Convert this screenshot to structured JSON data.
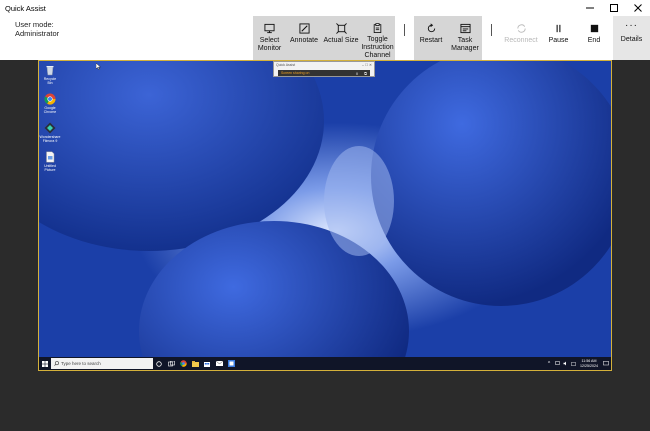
{
  "window": {
    "title": "Quick Assist",
    "minimize": "—",
    "maximize": "☐",
    "close": "✕"
  },
  "user_mode": {
    "label": "User mode:",
    "value": "Administrator"
  },
  "toolbar": {
    "select_monitor": [
      "Select",
      "Monitor"
    ],
    "annotate": "Annotate",
    "actual_size": "Actual Size",
    "toggle_channel": [
      "Toggle",
      "Instruction",
      "Channel"
    ],
    "restart": "Restart",
    "task_manager": [
      "Task",
      "Manager"
    ],
    "reconnect": "Reconnect",
    "pause": "Pause",
    "end": "End",
    "details": "Details"
  },
  "remote_desktop": {
    "icons": [
      {
        "name": "recycle-bin",
        "label": "Recycle Bin"
      },
      {
        "name": "chrome",
        "label": "Google Chrome"
      },
      {
        "name": "wondershare",
        "label": "Wondershare Filmora 9"
      },
      {
        "name": "untitled-picture",
        "label": "Untitled Picture"
      }
    ],
    "mini_quick_assist": {
      "title": "Quick Assist",
      "status": "Screen sharing on"
    },
    "taskbar": {
      "search_placeholder": "Type here to search",
      "time": "11:56 AM",
      "date": "12/25/2024"
    }
  },
  "colors": {
    "accent_border": "#d4b13a",
    "app_bg": "#2b2b2b",
    "taskbar": "#101528"
  }
}
